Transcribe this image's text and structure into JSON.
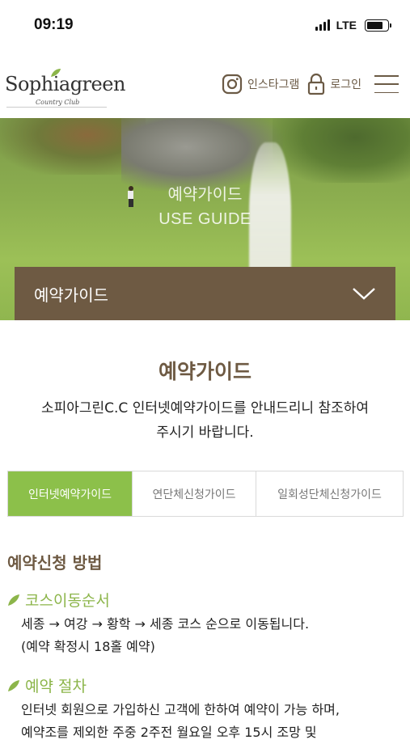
{
  "status": {
    "time": "09:19",
    "network": "LTE"
  },
  "header": {
    "logo_name": "Sophiagreen",
    "logo_sub": "Country Club",
    "instagram_label": "인스타그램",
    "login_label": "로그인"
  },
  "hero": {
    "title_ko": "예약가이드",
    "title_en": "USE GUIDE",
    "submenu_label": "예약가이드"
  },
  "main": {
    "title": "예약가이드",
    "intro_line1": "소피아그린C.C 인터넷예약가이드를 안내드리니 참조하여",
    "intro_line2": "주시기 바랍니다.",
    "tabs": [
      {
        "label": "인터넷예약가이드",
        "active": true
      },
      {
        "label": "연단체신청가이드",
        "active": false
      },
      {
        "label": "일회성단체신청가이드",
        "active": false
      }
    ],
    "section_title": "예약신청 방법",
    "course_order_title": "코스이동순서",
    "course_order_line1": "세종 → 여강 → 황학 → 세종 코스 순으로 이동됩니다.",
    "course_order_line2": "(예약 확정시 18홀 예약)",
    "procedure_title": "예약 절차",
    "procedure_line1": "인터넷 회원으로 가입하신 고객에 한하여 예약이 가능 하며,",
    "procedure_line2": "예약조를 제외한 주중 2주전 월요일 오후 15시 조망 및"
  },
  "colors": {
    "brand_brown": "#6e5a43",
    "accent_green": "#8cc04a"
  }
}
